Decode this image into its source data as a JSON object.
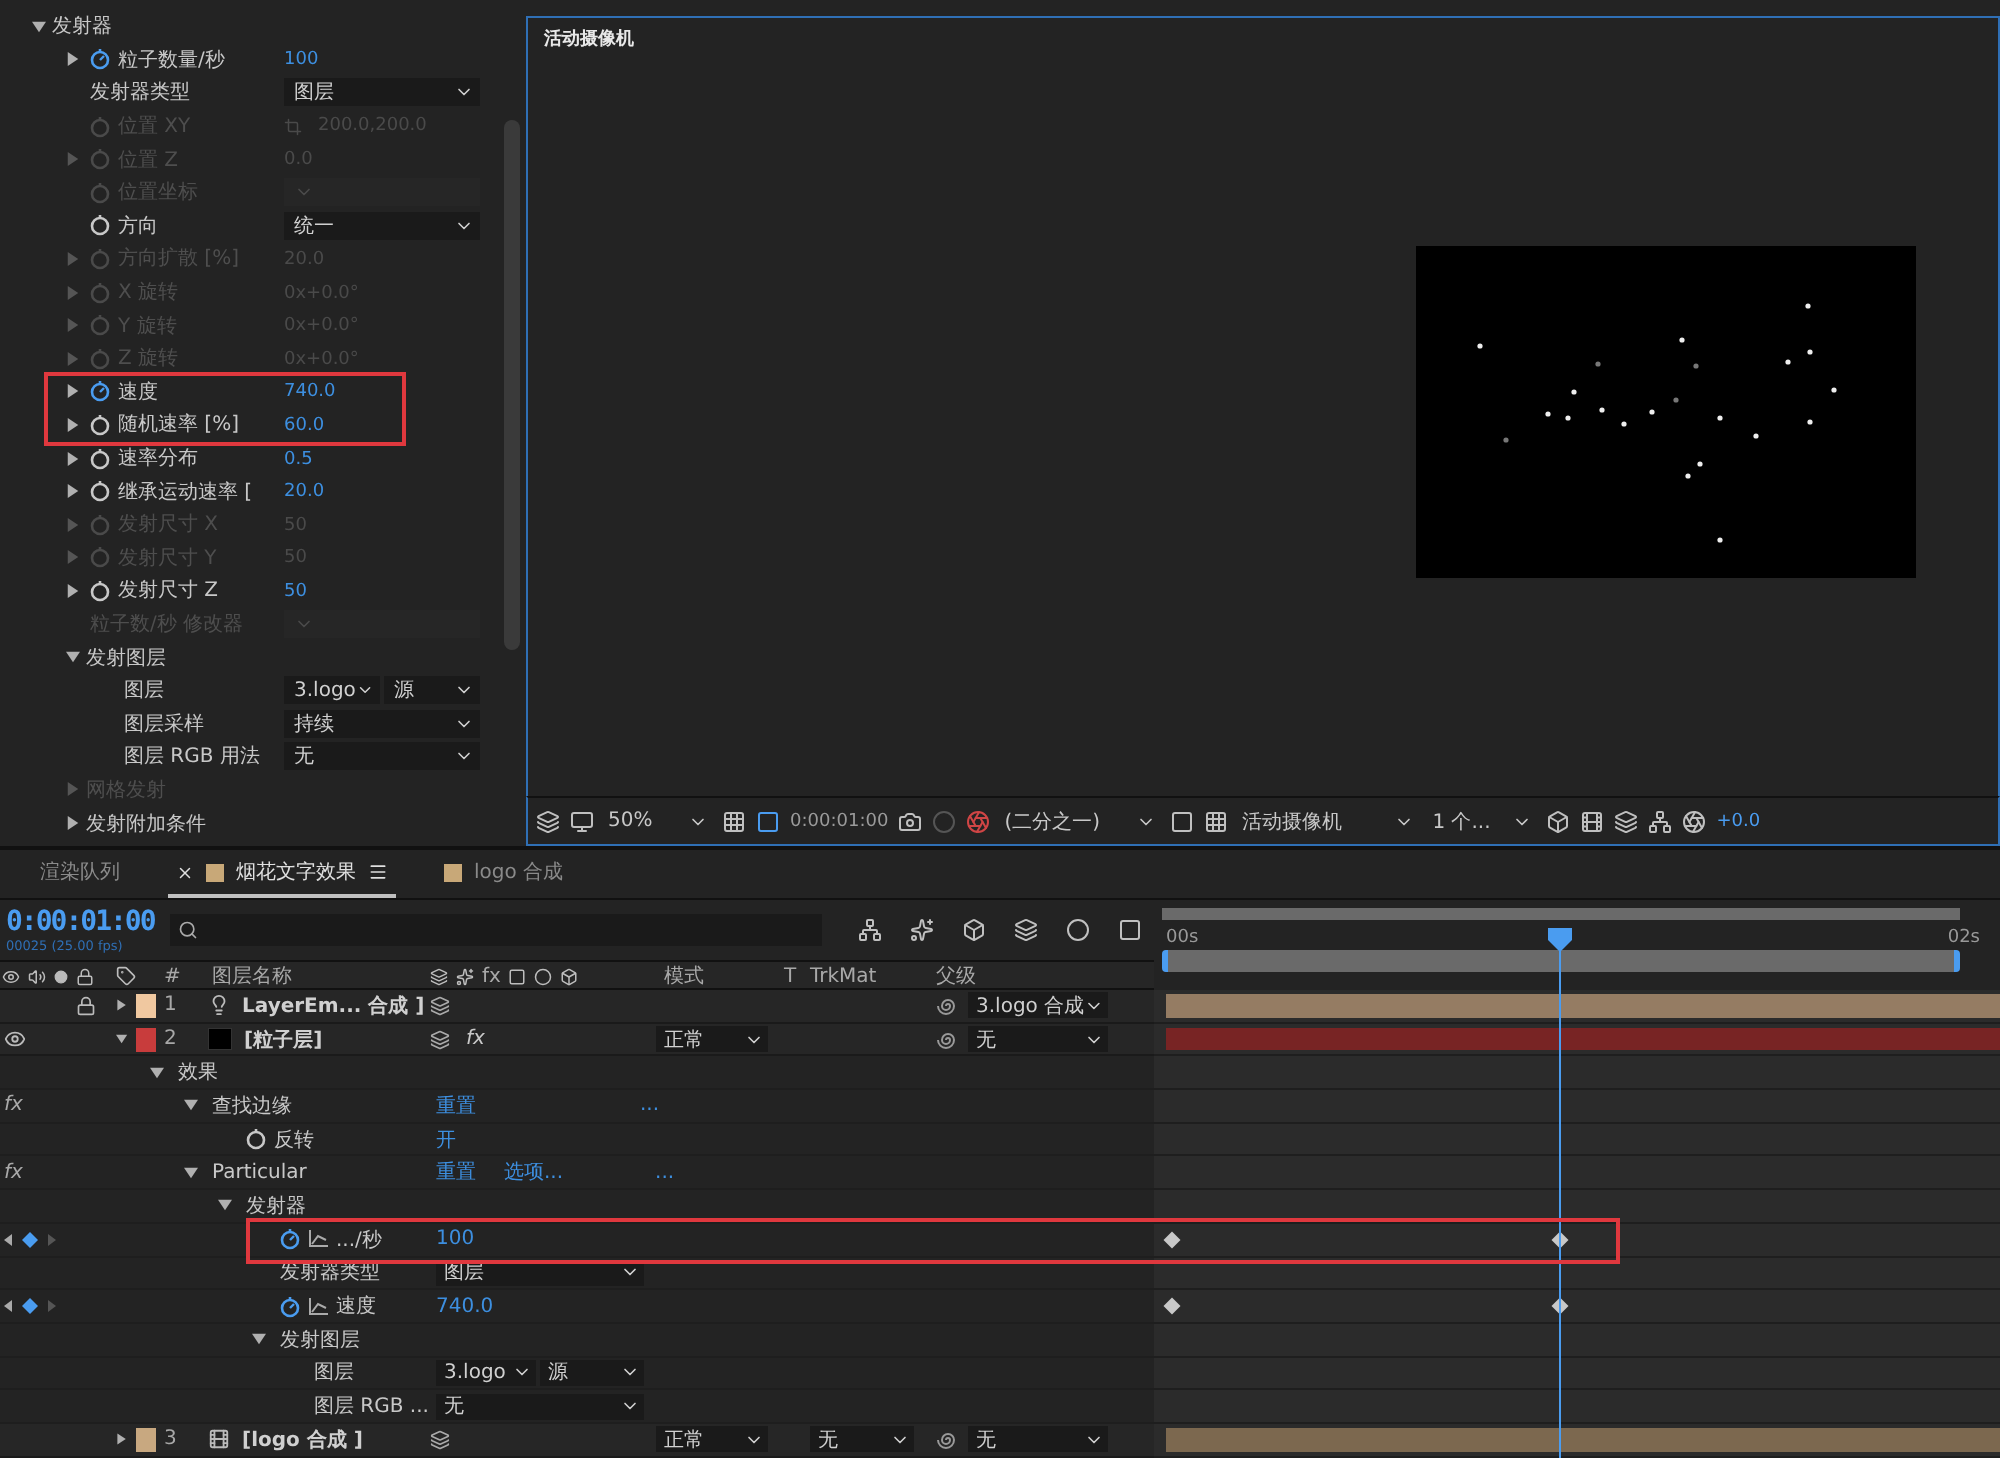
{
  "effect_controls": {
    "items": [
      {
        "kind": "group",
        "label": "发射器",
        "expanded": true,
        "disabled": false,
        "highlighted": false,
        "children": [
          {
            "kind": "number",
            "label": "粒子数量/秒",
            "expanded": false,
            "animated": true,
            "value": "100",
            "disabled": false,
            "highlighted": false
          },
          {
            "kind": "dropdown",
            "label": "发射器类型",
            "value": "图层",
            "disabled": false,
            "highlighted": false
          },
          {
            "kind": "point",
            "label": "位置 XY",
            "animated": false,
            "value": "200.0,200.0",
            "disabled": true,
            "highlighted": false
          },
          {
            "kind": "number",
            "label": "位置 Z",
            "expanded": false,
            "animated": false,
            "value": "0.0",
            "disabled": true,
            "highlighted": false
          },
          {
            "kind": "dropdown",
            "label": "位置坐标",
            "animated": false,
            "disabled": true,
            "highlighted": false
          },
          {
            "kind": "dropdown",
            "label": "方向",
            "animated": false,
            "value": "统一",
            "disabled": false,
            "highlighted": false
          },
          {
            "kind": "number",
            "label": "方向扩散 [%]",
            "expanded": false,
            "animated": false,
            "value": "20.0",
            "disabled": true,
            "highlighted": false
          },
          {
            "kind": "number",
            "label": "X 旋转",
            "expanded": false,
            "animated": false,
            "value": "0x+0.0°",
            "disabled": true,
            "highlighted": false
          },
          {
            "kind": "number",
            "label": "Y 旋转",
            "expanded": false,
            "animated": false,
            "value": "0x+0.0°",
            "disabled": true,
            "highlighted": false
          },
          {
            "kind": "number",
            "label": "Z 旋转",
            "expanded": false,
            "animated": false,
            "value": "0x+0.0°",
            "disabled": true,
            "highlighted": false
          },
          {
            "kind": "number",
            "label": "速度",
            "expanded": false,
            "animated": true,
            "value": "740.0",
            "disabled": false,
            "highlighted": true
          },
          {
            "kind": "number",
            "label": "随机速率 [%]",
            "expanded": false,
            "animated": false,
            "value": "60.0",
            "disabled": false,
            "highlighted": true
          },
          {
            "kind": "number",
            "label": "速率分布",
            "expanded": false,
            "animated": false,
            "value": "0.5",
            "disabled": false,
            "highlighted": false
          },
          {
            "kind": "number",
            "label": "继承运动速率 [",
            "expanded": false,
            "animated": false,
            "value": "20.0",
            "disabled": false,
            "highlighted": false
          },
          {
            "kind": "number",
            "label": "发射尺寸 X",
            "expanded": false,
            "animated": false,
            "value": "50",
            "disabled": true,
            "highlighted": false
          },
          {
            "kind": "number",
            "label": "发射尺寸 Y",
            "expanded": false,
            "animated": false,
            "value": "50",
            "disabled": true,
            "highlighted": false
          },
          {
            "kind": "number",
            "label": "发射尺寸 Z",
            "expanded": false,
            "animated": false,
            "value": "50",
            "disabled": false,
            "highlighted": false
          },
          {
            "kind": "dropdown",
            "label": "粒子数/秒 修改器",
            "disabled": true,
            "highlighted": false
          },
          {
            "kind": "group",
            "label": "发射图层",
            "expanded": true,
            "disabled": false,
            "highlighted": false,
            "children": [
              {
                "kind": "dropdown_pair",
                "label": "图层",
                "values": [
                  "3.logo",
                  "源"
                ],
                "disabled": false,
                "highlighted": false
              },
              {
                "kind": "dropdown",
                "label": "图层采样",
                "value": "持续",
                "disabled": false,
                "highlighted": false
              },
              {
                "kind": "dropdown",
                "label": "图层 RGB 用法",
                "value": "无",
                "disabled": false,
                "highlighted": false
              }
            ]
          },
          {
            "kind": "group",
            "label": "网格发射",
            "expanded": false,
            "disabled": true,
            "highlighted": false
          },
          {
            "kind": "group",
            "label": "发射附加条件",
            "expanded": false,
            "disabled": false,
            "highlighted": false
          }
        ]
      }
    ]
  },
  "viewer": {
    "label": "活动摄像机"
  },
  "viewer_toolbar": {
    "zoom": "50%",
    "timecode": "0:00:01:00",
    "resolution": "(二分之一)",
    "camera": "活动摄像机",
    "views": "1 个...",
    "exposure": "+0.0"
  },
  "timeline": {
    "tabs": [
      {
        "kind": "panel",
        "label": "渲染队列",
        "selected": false
      },
      {
        "kind": "composition",
        "label": "烟花文字效果",
        "selected": true
      },
      {
        "kind": "composition",
        "label": "logo 合成",
        "selected": false
      }
    ],
    "current_time": "0:00:01:00",
    "frame_info": "00025 (25.00 fps)",
    "columns": [
      {
        "kind": "number",
        "label": "#"
      },
      {
        "kind": "name",
        "label": "图层名称"
      },
      {
        "kind": "switches",
        "label": "fx"
      },
      {
        "kind": "mode",
        "label": "模式"
      },
      {
        "kind": "t",
        "label": "T"
      },
      {
        "kind": "trkmat",
        "label": "TrkMat"
      },
      {
        "kind": "parent",
        "label": "父级"
      }
    ],
    "ruler": [
      "00s",
      "02s"
    ],
    "layers": [
      {
        "kind": "light",
        "number": "1",
        "name": "LayerEm... 合成 ]",
        "color": "#f0c8a0",
        "visible": false,
        "locked": true,
        "expanded": false,
        "parent": "3.logo 合成",
        "highlighted": false
      },
      {
        "kind": "solid",
        "number": "2",
        "name": "[粒子层]",
        "color": "#c83c3c",
        "visible": true,
        "locked": false,
        "expanded": true,
        "effects_switch": "fx",
        "effects_on": true,
        "mode": "正常",
        "parent": "无",
        "highlighted": false,
        "children": [
          {
            "kind": "group",
            "label": "效果",
            "expanded": true,
            "highlighted": false,
            "children": [
              {
                "kind": "effect",
                "marker": "fx",
                "label": "查找边缘",
                "expanded": true,
                "actions": [
                  "重置"
                ],
                "more": "...",
                "highlighted": false,
                "children": [
                  {
                    "kind": "text",
                    "label": "反转",
                    "animated": false,
                    "value": "开",
                    "highlighted": false
                  }
                ]
              },
              {
                "kind": "effect",
                "marker": "fx",
                "label": "Particular",
                "expanded": true,
                "actions": [
                  "重置",
                  "选项..."
                ],
                "more": "...",
                "highlighted": false,
                "children": [
                  {
                    "kind": "group",
                    "label": "发射器",
                    "expanded": true,
                    "highlighted": false,
                    "children": [
                      {
                        "kind": "number",
                        "label": ".../秒",
                        "animated": true,
                        "value": "100",
                        "highlighted": true
                      },
                      {
                        "kind": "dropdown",
                        "label": "发射器类型",
                        "value": "图层",
                        "highlighted": false
                      },
                      {
                        "kind": "number",
                        "label": "速度",
                        "animated": true,
                        "value": "740.0",
                        "highlighted": false
                      },
                      {
                        "kind": "group",
                        "label": "发射图层",
                        "expanded": true,
                        "highlighted": false,
                        "children": [
                          {
                            "kind": "dropdown_pair",
                            "label": "图层",
                            "values": [
                              "3.logo",
                              "源"
                            ],
                            "highlighted": false
                          },
                          {
                            "kind": "dropdown",
                            "label": "图层 RGB ...",
                            "value": "无",
                            "highlighted": false
                          }
                        ]
                      }
                    ]
                  }
                ]
              }
            ]
          }
        ]
      },
      {
        "kind": "comp",
        "number": "3",
        "name": "[logo 合成 ]",
        "color": "#c8a880",
        "visible": false,
        "locked": false,
        "expanded": false,
        "mode": "正常",
        "trkmat": "无",
        "parent": "无",
        "highlighted": false
      }
    ]
  }
}
